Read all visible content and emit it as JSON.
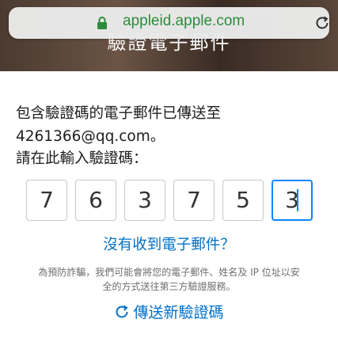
{
  "browser": {
    "url": "appleid.apple.com"
  },
  "header": {
    "title": "驗證電子郵件"
  },
  "message": {
    "line1": "包含驗證碼的電子郵件已傳送至",
    "line2": "4261366@qq.com。",
    "line3": "請在此輸入驗證碼："
  },
  "code": {
    "digits": [
      "7",
      "6",
      "3",
      "7",
      "5",
      "3"
    ]
  },
  "links": {
    "no_email": "沒有收到電子郵件？",
    "resend": "傳送新驗證碼"
  },
  "privacy": {
    "line1": "為預防詐騙，我們可能會將您的電子郵件、姓名及 IP 位址以安",
    "line2": "全的方式送往第三方驗證服務。"
  },
  "colors": {
    "link": "#0070c9",
    "url": "#2a8c3c",
    "focus": "#0a84ff"
  }
}
